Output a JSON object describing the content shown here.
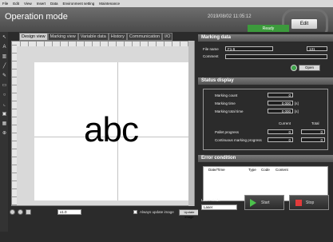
{
  "menu": [
    "File",
    "Edit",
    "View",
    "Insert",
    "Data",
    "Environment setting",
    "Maintenance"
  ],
  "header": {
    "title": "Operation mode",
    "datetime": "2019/08/02 11:05:12",
    "edit_label": "Edit",
    "status": "Ready"
  },
  "tools": [
    "arrow-icon",
    "text-icon",
    "barcode-icon",
    "line-icon",
    "pen-icon",
    "rectangle-icon",
    "circle-icon",
    "graph-icon",
    "image-icon",
    "2d-code-icon",
    "logo-icon"
  ],
  "tabs": [
    "Design view",
    "Marking view",
    "Variable data",
    "History",
    "Communication",
    "I/O"
  ],
  "canvas": {
    "text": "abc"
  },
  "bottom": {
    "zoom": "x1.0",
    "always_update": "Always update image",
    "update_label": "Update image"
  },
  "marking_data": {
    "title": "Marking data",
    "file_name_label": "File name",
    "file_name_value": "F1-6",
    "file_number": "131",
    "comment_label": "Comment",
    "comment_value": "",
    "open_label": "Open"
  },
  "status_display": {
    "title": "Status display",
    "marking_count_label": "Marking count",
    "marking_count_value": "0",
    "marking_time_label": "Marking time",
    "marking_time_value": "0.000",
    "marking_time_unit": "[s]",
    "total_time_label": "Marking total time",
    "total_time_value": "0.000",
    "total_time_unit": "[s]",
    "current_label": "Current",
    "total_label": "Total",
    "pallet_label": "Pallet progress",
    "pallet_current": "0",
    "pallet_total": "0",
    "continuous_label": "Continuous marking progress",
    "continuous_current": "0",
    "continuous_total": "0"
  },
  "error_condition": {
    "title": "Error condition",
    "columns": [
      "Date/Time",
      "Type",
      "Code",
      "Content"
    ],
    "cancel_label": "Cancel error"
  },
  "laser": {
    "mode_label": "Laser mode",
    "mode_value": "Laser",
    "start_label": "Start",
    "stop_label": "Stop"
  },
  "colors": {
    "ready": "#3c9a3c",
    "start": "#4cc24c",
    "stop": "#e23b3b"
  }
}
